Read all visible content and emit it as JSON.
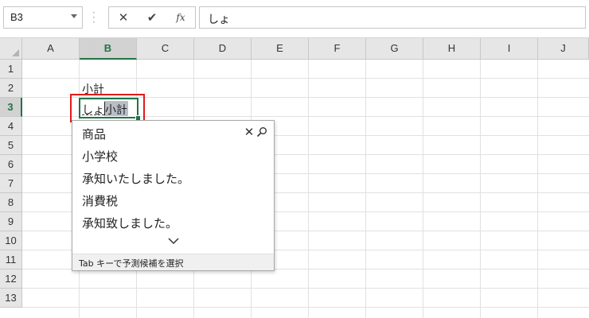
{
  "formula_bar": {
    "name_box": "B3",
    "cancel_symbol": "✕",
    "enter_symbol": "✔",
    "function_symbol": "fx",
    "content": "しょ"
  },
  "columns": [
    "A",
    "B",
    "C",
    "D",
    "E",
    "F",
    "G",
    "H",
    "I",
    "J"
  ],
  "selected_column": "B",
  "rows": [
    "1",
    "2",
    "3",
    "4",
    "5",
    "6",
    "7",
    "8",
    "9",
    "10",
    "11",
    "12",
    "13"
  ],
  "selected_row": "3",
  "cells": {
    "b2": "小計",
    "b3_typed": "しょ",
    "b3_suggestion": "小計"
  },
  "autocomplete": {
    "close_symbol": "✕",
    "items": [
      "商品",
      "小学校",
      "承知いたしました。",
      "消費税",
      "承知致しました。"
    ],
    "footer": "Tab キーで予測候補を選択"
  },
  "colors": {
    "excel_green": "#217346",
    "highlight_red": "#e21b1b"
  }
}
